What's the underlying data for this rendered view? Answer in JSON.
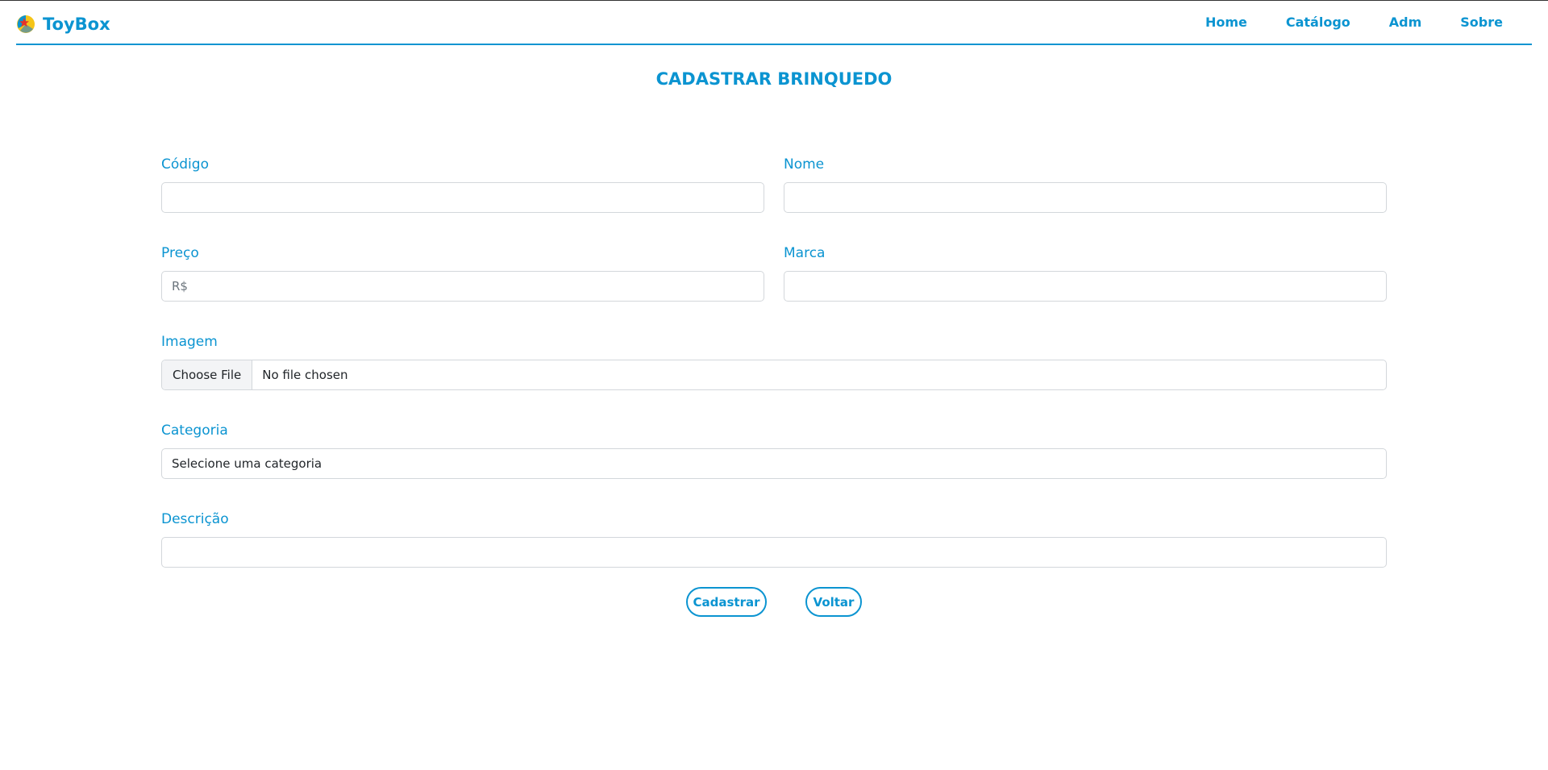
{
  "brand": {
    "name": "ToyBox"
  },
  "nav": {
    "home": "Home",
    "catalog": "Catálogo",
    "admin": "Adm",
    "about": "Sobre"
  },
  "page": {
    "title": "CADASTRAR BRINQUEDO"
  },
  "form": {
    "code": {
      "label": "Código",
      "value": "",
      "placeholder": ""
    },
    "name": {
      "label": "Nome",
      "value": "",
      "placeholder": ""
    },
    "price": {
      "label": "Preço",
      "value": "",
      "placeholder": "R$"
    },
    "brand": {
      "label": "Marca",
      "value": "",
      "placeholder": ""
    },
    "image": {
      "label": "Imagem",
      "button": "Choose File",
      "status": "No file chosen"
    },
    "category": {
      "label": "Categoria",
      "selected": "Selecione uma categoria"
    },
    "description": {
      "label": "Descrição",
      "value": "",
      "placeholder": ""
    },
    "submit_label": "Cadastrar",
    "back_label": "Voltar"
  },
  "colors": {
    "accent": "#0b94d1",
    "border": "#d3d7db"
  },
  "icons": {
    "logo": "luxo-ball-icon"
  }
}
